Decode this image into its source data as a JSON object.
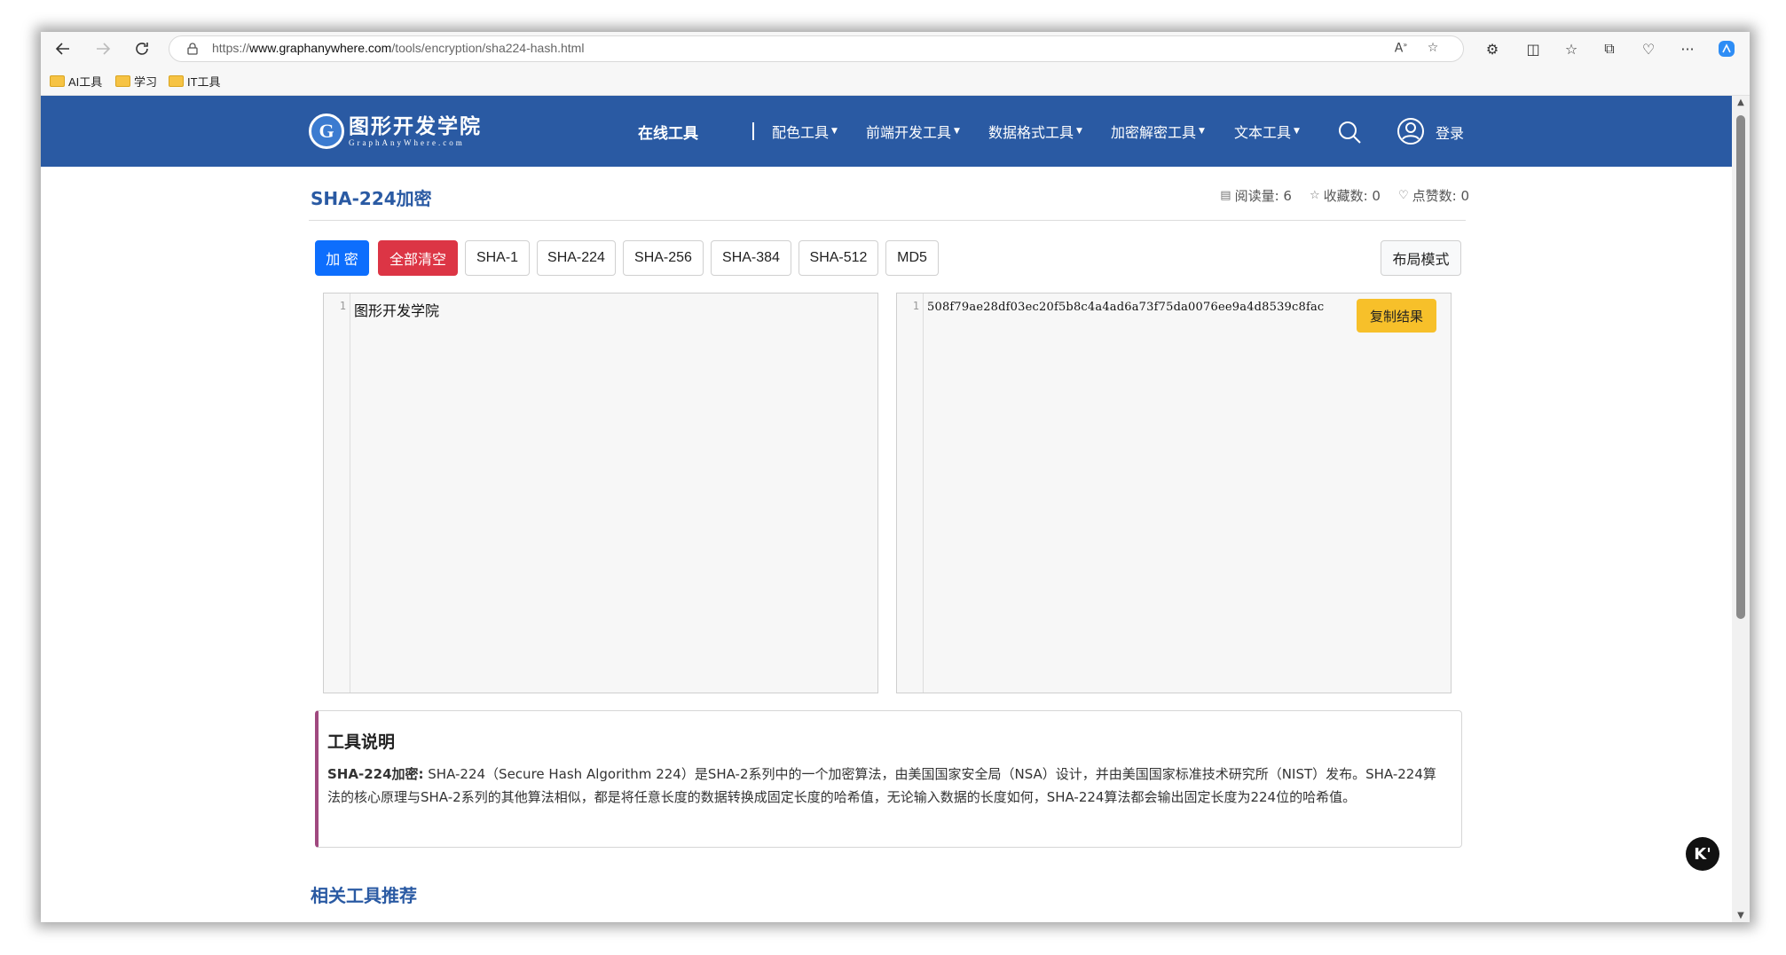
{
  "browser": {
    "url_prefix": "https://",
    "url_host": "www.graphanywhere.com",
    "url_path": "/tools/encryption/sha224-hash.html",
    "bookmarks": [
      {
        "label": "AI工具"
      },
      {
        "label": "学习"
      },
      {
        "label": "IT工具"
      }
    ]
  },
  "header": {
    "logo_title": "图形开发学院",
    "logo_subtitle": "GraphAnyWhere.com",
    "logo_letter": "G",
    "nav": {
      "online": "在线工具",
      "color": "配色工具",
      "frontend": "前端开发工具",
      "dataformat": "数据格式工具",
      "crypto": "加密解密工具",
      "text": "文本工具"
    },
    "login": "登录"
  },
  "page": {
    "title": "SHA-224加密",
    "stats": {
      "reads": "阅读量: 6",
      "favorites": "收藏数: 0",
      "likes": "点赞数: 0"
    }
  },
  "toolbar": {
    "encrypt": "加 密",
    "clear": "全部清空",
    "algorithms": [
      "SHA-1",
      "SHA-224",
      "SHA-256",
      "SHA-384",
      "SHA-512",
      "MD5"
    ],
    "layout": "布局模式"
  },
  "editors": {
    "input_line": "1",
    "input_text": "图形开发学院",
    "output_line": "1",
    "output_text": "508f79ae28df03ec20f5b8c4a4ad6a73f75da0076ee9a4d8539c8fac",
    "copy": "复制结果"
  },
  "description": {
    "title": "工具说明",
    "label": "SHA-224加密:",
    "body": " SHA-224（Secure Hash Algorithm 224）是SHA-2系列中的一个加密算法，由美国国家安全局（NSA）设计，并由美国国家标准技术研究所（NIST）发布。SHA-224算法的核心原理与SHA-2系列的其他算法相似，都是将任意长度的数据转换成固定长度的哈希值，无论输入数据的长度如何，SHA-224算法都会输出固定长度为224位的哈希值。"
  },
  "related": {
    "title": "相关工具推荐"
  },
  "float_button": "K'",
  "colors": {
    "header_bg": "#2a5aa3",
    "primary": "#0d6efd",
    "danger": "#dc3545",
    "warning": "#f7c02a",
    "desc_accent": "#a0497f"
  }
}
